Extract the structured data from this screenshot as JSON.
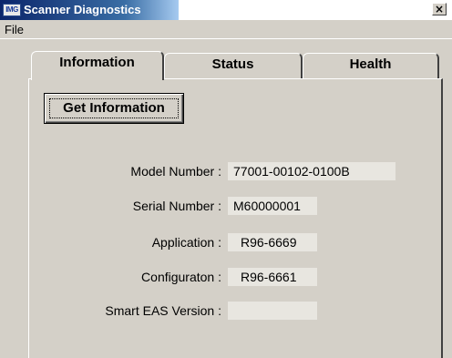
{
  "window": {
    "title": "Scanner Diagnostics",
    "icon_text": "IMG",
    "close_glyph": "×"
  },
  "menu": {
    "file": "File"
  },
  "tabs": [
    {
      "label": "Information",
      "active": true
    },
    {
      "label": "Status",
      "active": false
    },
    {
      "label": "Health",
      "active": false
    }
  ],
  "information": {
    "get_info_button": "Get Information",
    "fields": {
      "model_number": {
        "label": "Model Number :",
        "value": "77001-00102-0100B"
      },
      "serial_number": {
        "label": "Serial Number :",
        "value": "M60000001"
      },
      "application": {
        "label": "Application :",
        "value": "R96-6669"
      },
      "configuration": {
        "label": "Configuraton :",
        "value": "R96-6661"
      },
      "smart_eas": {
        "label": "Smart EAS Version :",
        "value": ""
      }
    }
  },
  "colors": {
    "title_gradient_start": "#0a246a",
    "title_gradient_end": "#a6caf0",
    "face": "#d4d0c8"
  }
}
